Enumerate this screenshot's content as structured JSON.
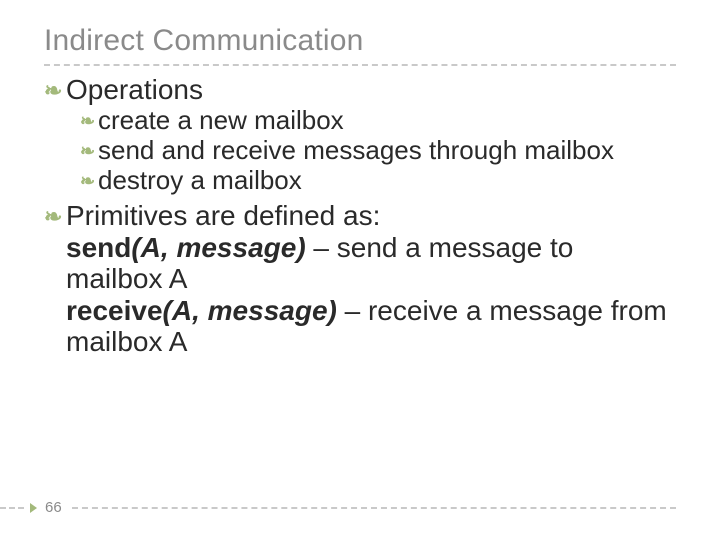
{
  "title": "Indirect Communication",
  "bullets": {
    "ops_label": "Operations",
    "ops_items": [
      "create a new mailbox",
      "send and receive messages through mailbox",
      "destroy a mailbox"
    ],
    "prim_label": "Primitives are defined as:",
    "prim_lines": {
      "send_kw": "send",
      "send_args": "(A, message)",
      "send_rest": " – send a message to mailbox A",
      "recv_kw": "receive",
      "recv_args": "(A, message)",
      "recv_rest": " – receive a message from mailbox A"
    }
  },
  "page_number": "66",
  "bullet_glyph": "❧"
}
